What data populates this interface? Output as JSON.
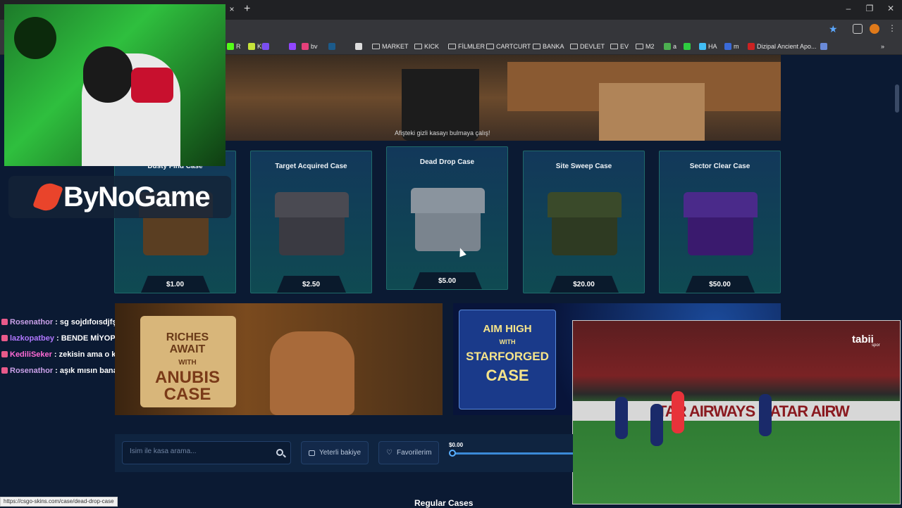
{
  "browser": {
    "close_tab": "×",
    "new_tab": "+",
    "window_controls": {
      "minimize": "–",
      "restore": "❐",
      "close": "✕"
    },
    "bookmarks": [
      {
        "label": "R",
        "icon": "kick-icon",
        "color": "#53fc18"
      },
      {
        "label": "KL",
        "icon": "star-icon",
        "color": "#c6e33a"
      },
      {
        "label": "",
        "icon": "purple-app-icon",
        "color": "#7a4ef2"
      },
      {
        "label": "",
        "icon": "twitch-icon",
        "color": "#9146ff"
      },
      {
        "label": "bv",
        "icon": "pink-icon",
        "color": "#e6407a"
      },
      {
        "label": "",
        "icon": "steam-icon",
        "color": "#1b5a8a"
      },
      {
        "label": "",
        "icon": "circle-icon",
        "color": "#dddddd"
      },
      {
        "label": "MARKET",
        "icon": "folder-icon",
        "color": "#cccccc"
      },
      {
        "label": "KICK",
        "icon": "folder-icon",
        "color": "#cccccc"
      },
      {
        "label": "FİLMLER",
        "icon": "folder-icon",
        "color": "#cccccc"
      },
      {
        "label": "CARTCURT",
        "icon": "folder-icon",
        "color": "#cccccc"
      },
      {
        "label": "BANKA",
        "icon": "folder-icon",
        "color": "#cccccc"
      },
      {
        "label": "DEVLET",
        "icon": "folder-icon",
        "color": "#cccccc"
      },
      {
        "label": "EV",
        "icon": "folder-icon",
        "color": "#cccccc"
      },
      {
        "label": "M2",
        "icon": "folder-icon",
        "color": "#cccccc"
      },
      {
        "label": "a",
        "icon": "leaf-icon",
        "color": "#4caf50"
      },
      {
        "label": "",
        "icon": "green-icon",
        "color": "#2ecc40"
      },
      {
        "label": "HA",
        "icon": "ha-icon",
        "color": "#41bdf5"
      },
      {
        "label": "m",
        "icon": "m-icon",
        "color": "#3a6ad8"
      },
      {
        "label": "Dizipal Ancient Apo...",
        "icon": "dizipal-icon",
        "color": "#cc2222"
      },
      {
        "label": "",
        "icon": "minus-icon",
        "color": "#6a8ad8"
      }
    ],
    "more_bookmarks": "»",
    "status_url": "https://csgo-skins.com/case/dead-drop-case"
  },
  "logo": {
    "text": "ByNoGame"
  },
  "banner_top": {
    "caption": "Afişteki gizli kasayı bulmaya çalış!"
  },
  "cases": [
    {
      "name": "Dusty Find Case",
      "price": "$1.00",
      "lid": "#6e4e2e",
      "body": "#5a3e22"
    },
    {
      "name": "Target Acquired Case",
      "price": "$2.50",
      "lid": "#4a4a52",
      "body": "#3a3a42"
    },
    {
      "name": "Dead Drop Case",
      "price": "$5.00",
      "lid": "#8a949e",
      "body": "#7a848e"
    },
    {
      "name": "Site Sweep Case",
      "price": "$20.00",
      "lid": "#3a4a2a",
      "body": "#2e3a22"
    },
    {
      "name": "Sector Clear Case",
      "price": "$50.00",
      "lid": "#4a2a8a",
      "body": "#3a1a6e"
    }
  ],
  "chat": [
    {
      "user": "Rosenathor",
      "color": "#c9a0e8",
      "message": ": sg sojdıfoısdjfş"
    },
    {
      "user": "lazkopatbey",
      "color": "#b077ff",
      "message": ": BENDE MİYOP VAR"
    },
    {
      "user": "KediliSeker",
      "color": "#ff6ad5",
      "message": ": zekisin ama o kadar degil :D"
    },
    {
      "user": "Rosenathor",
      "color": "#c9a0e8",
      "message": ": aşık mısın bana"
    }
  ],
  "anubis": {
    "line1": "RICHES AWAIT",
    "line2": "WITH",
    "line3": "ANUBIS",
    "line4": "CASE"
  },
  "starforged": {
    "line1": "AIM HIGH",
    "line2": "WITH",
    "line3": "STARFORGED",
    "line4": "CASE"
  },
  "soccer": {
    "board": "TAR AIRWAYS    QATAR AIRW",
    "broadcaster": "tabii",
    "broadcaster_sub": "spor"
  },
  "filters": {
    "search_placeholder": "İsim ile kasa arama...",
    "sufficient_balance": "Yeterli bakiye",
    "favorites": "Favorilerim",
    "price_min": "$0.00",
    "price_min_value": 0
  },
  "regular_cases_heading": "Regular Cases"
}
